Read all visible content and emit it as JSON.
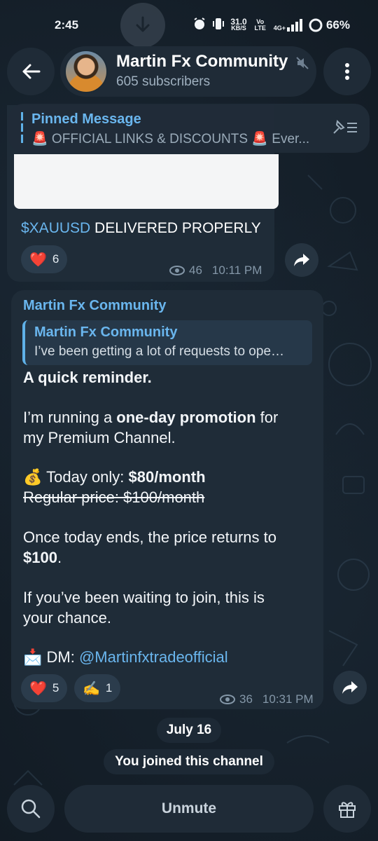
{
  "status_bar": {
    "time": "2:45",
    "network_speed": "31.0",
    "network_speed_unit": "KB/S",
    "volte": "Vo LTE",
    "signal_type": "4G+",
    "battery": "66%"
  },
  "header": {
    "channel_name": "Martin Fx Community",
    "subscribers": "605 subscribers"
  },
  "pinned": {
    "title": "Pinned Message",
    "text": "🚨 OFFICIAL LINKS & DISCOUNTS 🚨 Ever..."
  },
  "post1": {
    "tag": "$XAUUSD",
    "text": " DELIVERED PROPERLY",
    "reaction_emoji": "❤️",
    "reaction_count": "6",
    "views": "46",
    "time": "10:11 PM"
  },
  "post2": {
    "author": "Martin Fx Community",
    "quote_author": "Martin Fx Community",
    "quote_text": "I’ve been getting a lot of requests to ope…",
    "line1": "A quick reminder.",
    "line2_a": "I’m running a ",
    "line2_b": "one-day promotion",
    "line2_c": " for",
    "line3": "my Premium Channel.",
    "promo_emoji": "💰",
    "today_label": " Today only: ",
    "today_price": "$80/month",
    "regular": "Regular price: $100/month",
    "line4": "Once today ends, the price returns to",
    "line5": "$100",
    "line5_end": ".",
    "line6": "If you’ve been waiting to join, this is",
    "line7": "your chance.",
    "dm_emoji": "📩",
    "dm_label": " DM: ",
    "dm_handle": "@Martinfxtradeofficial",
    "reaction1_emoji": "❤️",
    "reaction1_count": "5",
    "reaction2_emoji": "✍️",
    "reaction2_count": "1",
    "views": "36",
    "time": "10:31 PM"
  },
  "date_separator": "July 16",
  "service_message": "You joined this channel",
  "bottom": {
    "unmute_label": "Unmute"
  },
  "colors": {
    "accent": "#6ab6ee",
    "bubble": "#1f2c38",
    "background": "#121b24"
  }
}
